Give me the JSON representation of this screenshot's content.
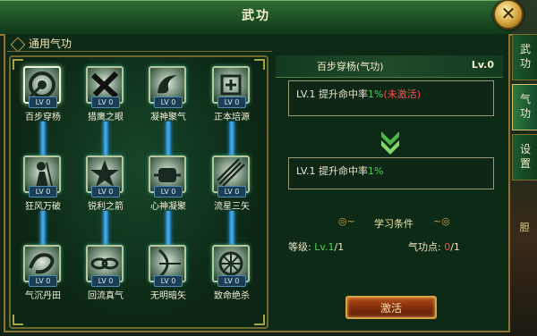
{
  "window": {
    "title": "武功"
  },
  "section": {
    "title": "通用气功"
  },
  "skills": [
    {
      "name": "百步穿杨",
      "level": "LV 0",
      "icon": "target-icon"
    },
    {
      "name": "猎鹰之眼",
      "level": "LV 0",
      "icon": "crossed-blades-icon"
    },
    {
      "name": "凝神聚气",
      "level": "LV 0",
      "icon": "swirl-icon"
    },
    {
      "name": "正本培源",
      "level": "LV 0",
      "icon": "rune-icon"
    },
    {
      "name": "狂风万破",
      "level": "LV 0",
      "icon": "warrior-icon"
    },
    {
      "name": "锐利之箭",
      "level": "LV 0",
      "icon": "burst-icon"
    },
    {
      "name": "心神凝聚",
      "level": "LV 0",
      "icon": "fist-icon"
    },
    {
      "name": "流星三矢",
      "level": "LV 0",
      "icon": "arrows-icon"
    },
    {
      "name": "气沉丹田",
      "level": "LV 0",
      "icon": "dragon-icon"
    },
    {
      "name": "回流真气",
      "level": "LV 0",
      "icon": "chains-icon"
    },
    {
      "name": "无明暗矢",
      "level": "LV 0",
      "icon": "archer-icon"
    },
    {
      "name": "致命绝杀",
      "level": "LV 0",
      "icon": "wheel-icon"
    }
  ],
  "detail": {
    "title": "百步穿杨(气功)",
    "level": "Lv.0",
    "current_prefix": "LV.1 提升命中率",
    "current_value": "1%",
    "current_status": "(未激活)",
    "next_prefix": "LV.1 提升命中率",
    "next_value": "1%",
    "conditions_title": "学习条件",
    "level_req_label": "等级:",
    "level_req_value": "Lv.1",
    "level_req_total": "/1",
    "points_label": "气功点:",
    "points_have": "0",
    "points_total": "/1",
    "activate_label": "激活"
  },
  "tabs": [
    {
      "label": "武功",
      "active": false
    },
    {
      "label": "气功",
      "active": true
    },
    {
      "label": "设置",
      "active": false
    }
  ],
  "side_deco": {
    "label": "胆"
  },
  "colors": {
    "accent_green": "#4fd15a",
    "warning_red": "#ff4a4a",
    "gold_frame": "#9a7a38"
  }
}
